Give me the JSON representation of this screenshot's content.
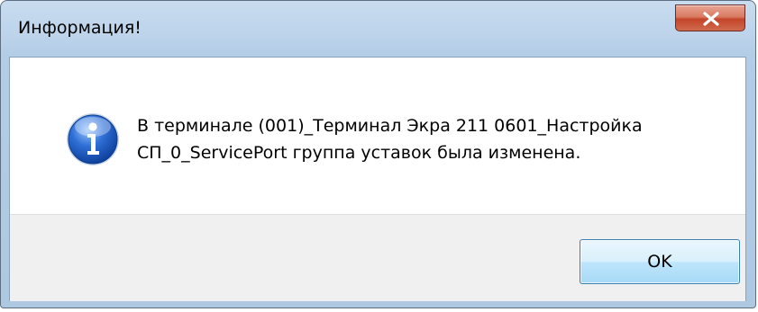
{
  "window": {
    "title": "Информация!",
    "close_icon": "close-x-icon"
  },
  "message": {
    "icon": "info-icon",
    "line1": "В терминале (001)_Терминал Экра 211 0601_Настройка",
    "line2": "СП_0_ServicePort группа уставок была изменена."
  },
  "buttons": {
    "ok_label": "OK"
  },
  "colors": {
    "titlebar": "#bcd3ea",
    "close_button": "#c4452a",
    "footer": "#f0f0f0",
    "ok_button_border": "#3c7fb1"
  }
}
